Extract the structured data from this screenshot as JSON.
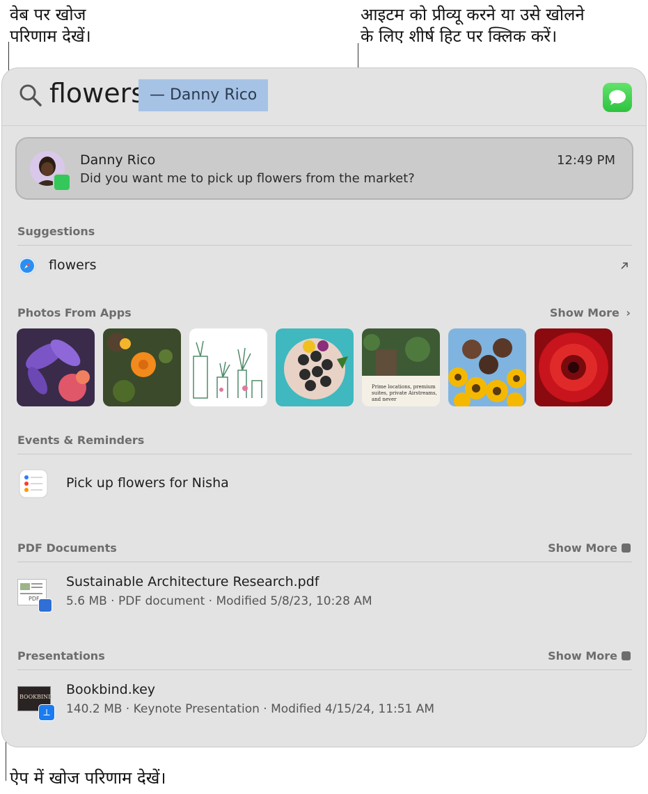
{
  "callouts": {
    "web_line1": "वेब पर खोज",
    "web_line2": "परिणाम देखें।",
    "tophit_line1": "आइटम को प्रीव्यू करने या उसे खोलने",
    "tophit_line2": "के लिए शीर्ष हिट पर क्लिक करें।",
    "apps": "ऐप में खोज परिणाम देखें।"
  },
  "search": {
    "query": "flowers",
    "completion": "—  Danny Rico",
    "app_icon": "messages-icon"
  },
  "top_hit": {
    "name": "Danny Rico",
    "message": "Did you want me to pick up flowers from the market?",
    "time": "12:49 PM"
  },
  "suggestions": {
    "title": "Suggestions",
    "item": "flowers",
    "icon": "safari-icon"
  },
  "photos": {
    "title": "Photos From Apps",
    "show_more": "Show More",
    "doc_text": "Prime locations, premium suites, private Airstreams, and never"
  },
  "events": {
    "title": "Events & Reminders",
    "item": "Pick up flowers for Nisha"
  },
  "pdf": {
    "title": "PDF Documents",
    "show_more": "Show More",
    "name": "Sustainable Architecture Research.pdf",
    "details": "5.6 MB · PDF document · Modified 5/8/23, 10:28 AM",
    "badge": "PDF"
  },
  "presentations": {
    "title": "Presentations",
    "show_more": "Show More",
    "name": "Bookbind.key",
    "details": "140.2 MB · Keynote Presentation · Modified 4/15/24, 11:51 AM",
    "thumb_label": "BOOKBIND"
  },
  "colors": {
    "panel": "#e3e3e3",
    "highlight": "#a6c3e6",
    "messages_green": "#34c759",
    "keynote_blue": "#1a7cf0"
  }
}
